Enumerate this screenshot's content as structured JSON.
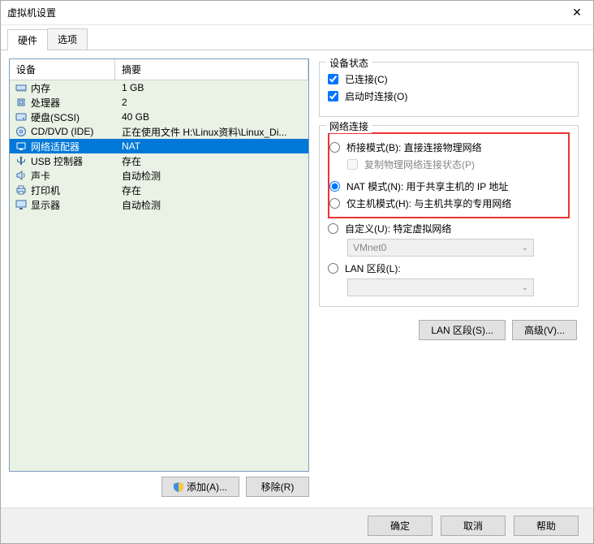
{
  "window": {
    "title": "虚拟机设置"
  },
  "tabs": {
    "hardware": "硬件",
    "options": "选项"
  },
  "columns": {
    "device": "设备",
    "summary": "摘要"
  },
  "devices": [
    {
      "icon": "memory",
      "name": "内存",
      "summary": "1 GB",
      "selected": false
    },
    {
      "icon": "cpu",
      "name": "处理器",
      "summary": "2",
      "selected": false
    },
    {
      "icon": "disk",
      "name": "硬盘(SCSI)",
      "summary": "40 GB",
      "selected": false
    },
    {
      "icon": "cd",
      "name": "CD/DVD (IDE)",
      "summary": "正在使用文件 H:\\Linux资料\\Linux_Di...",
      "selected": false
    },
    {
      "icon": "net",
      "name": "网络适配器",
      "summary": "NAT",
      "selected": true
    },
    {
      "icon": "usb",
      "name": "USB 控制器",
      "summary": "存在",
      "selected": false
    },
    {
      "icon": "sound",
      "name": "声卡",
      "summary": "自动检测",
      "selected": false
    },
    {
      "icon": "printer",
      "name": "打印机",
      "summary": "存在",
      "selected": false
    },
    {
      "icon": "display",
      "name": "显示器",
      "summary": "自动检测",
      "selected": false
    }
  ],
  "listButtons": {
    "add": "添加(A)...",
    "remove": "移除(R)"
  },
  "deviceState": {
    "group": "设备状态",
    "connected": "已连接(C)",
    "connectOnStart": "启动时连接(O)"
  },
  "networkConnection": {
    "group": "网络连接",
    "bridged": "桥接模式(B): 直接连接物理网络",
    "replicate": "复制物理网络连接状态(P)",
    "nat": "NAT 模式(N): 用于共享主机的 IP 地址",
    "hostonly": "仅主机模式(H): 与主机共享的专用网络",
    "custom": "自定义(U): 特定虚拟网络",
    "customDropdown": "VMnet0",
    "lanSegment": "LAN 区段(L):",
    "lanDropdown": ""
  },
  "rightButtons": {
    "lanSegments": "LAN 区段(S)...",
    "advanced": "高级(V)..."
  },
  "footer": {
    "ok": "确定",
    "cancel": "取消",
    "help": "帮助"
  }
}
